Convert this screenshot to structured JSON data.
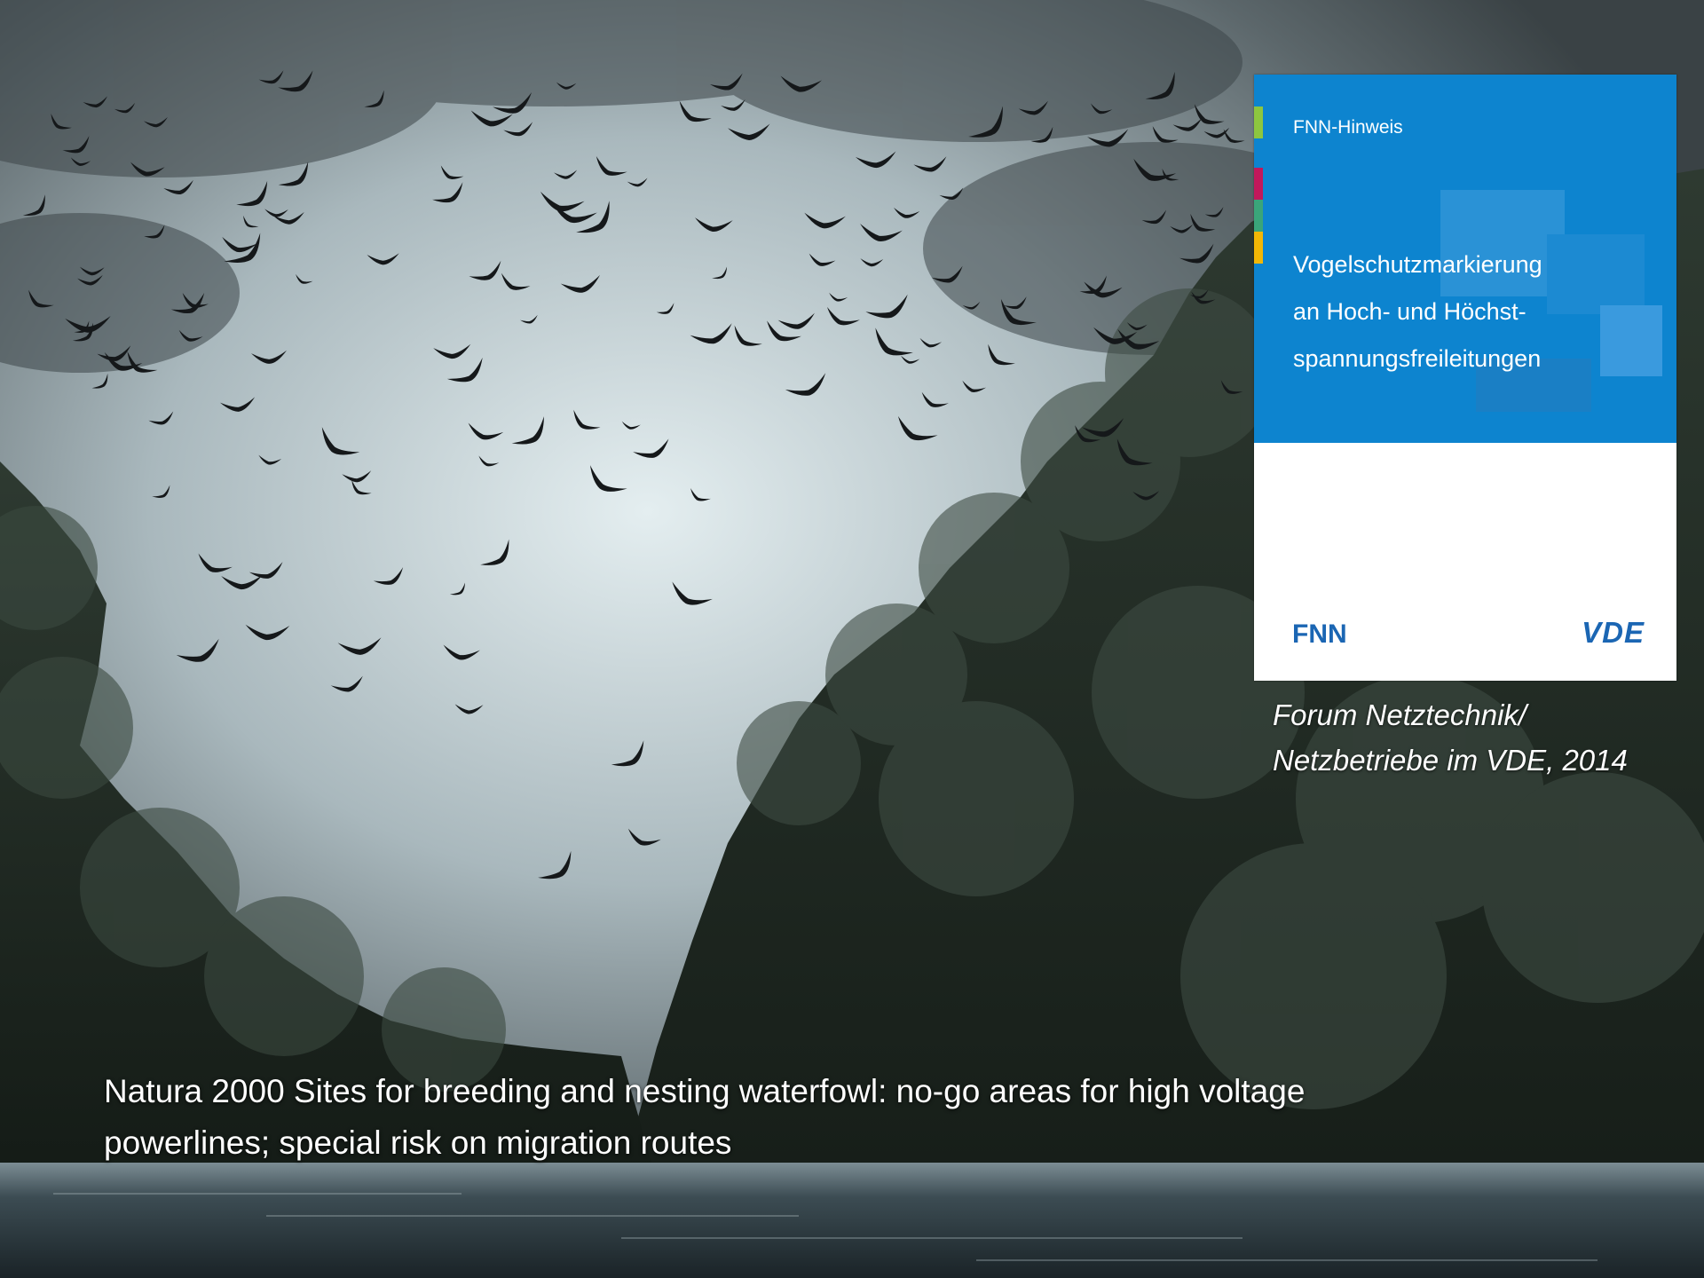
{
  "photo": {
    "subject": "flock-of-birds-over-river",
    "colors": {
      "sky_light": "#dfe9ec",
      "sky_dark": "#4a5357",
      "trees": "#1e2a22",
      "water": "#2f3d44",
      "birds": "#15181a"
    }
  },
  "cover": {
    "kicker": "FNN-Hinweis",
    "title_lines": [
      "Vogelschutzmarkierung",
      "an Hoch- und Höchst-",
      "spannungsfreileitungen"
    ],
    "logo_left": "FNN",
    "logo_right": "VDE",
    "colors": {
      "band": "#0d84cf",
      "logo": "#1b66b3",
      "strip_1": "#8dc63f",
      "strip_2": "#c2185b",
      "strip_3": "#3aa57a",
      "strip_4": "#f2b705"
    }
  },
  "source": {
    "lines": [
      "Forum Netztechnik/",
      "Netzbetriebe im VDE, 2014"
    ]
  },
  "caption": {
    "lines": [
      "Natura 2000 Sites for breeding and nesting waterfowl: no-go areas for high voltage",
      "powerlines; special risk on migration routes"
    ]
  }
}
